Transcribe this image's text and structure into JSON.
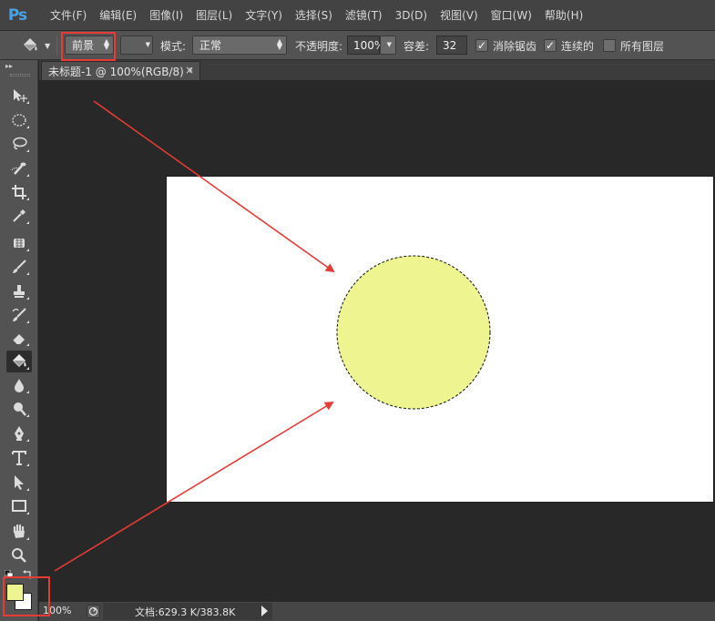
{
  "app": {
    "logo": "Ps"
  },
  "menu": [
    "文件(F)",
    "编辑(E)",
    "图像(I)",
    "图层(L)",
    "文字(Y)",
    "选择(S)",
    "滤镜(T)",
    "3D(D)",
    "视图(V)",
    "窗口(W)",
    "帮助(H)"
  ],
  "options": {
    "tool_icon": "paint-bucket-icon",
    "fill_source": "前景",
    "mode_label": "模式:",
    "mode_value": "正常",
    "opacity_label": "不透明度:",
    "opacity_value": "100%",
    "tolerance_label": "容差:",
    "tolerance_value": "32",
    "antialias_label": "消除锯齿",
    "antialias_checked": true,
    "contiguous_label": "连续的",
    "contiguous_checked": true,
    "all_layers_label": "所有图层",
    "all_layers_checked": false
  },
  "document_tab": {
    "title": "未标题-1 @ 100%(RGB/8) *",
    "close": "×"
  },
  "canvas": {
    "background": "#ffffff",
    "shape": "circle-selection",
    "fill_color": "#eef590"
  },
  "colors": {
    "foreground": "#eef590",
    "background": "#ffffff",
    "annotation": "#e63c35"
  },
  "statusbar": {
    "zoom": "100%",
    "doc_info": "文档:629.3 K/383.8K"
  },
  "tools": [
    "move-icon",
    "elliptical-marquee-icon",
    "lasso-icon",
    "quick-selection-icon",
    "crop-icon",
    "eyedropper-icon",
    "spot-healing-icon",
    "brush-icon",
    "clone-stamp-icon",
    "history-brush-icon",
    "eraser-icon",
    "paint-bucket-icon",
    "blur-icon",
    "dodge-icon",
    "pen-icon",
    "type-icon",
    "path-selection-icon",
    "rectangle-icon",
    "hand-icon",
    "zoom-icon"
  ]
}
